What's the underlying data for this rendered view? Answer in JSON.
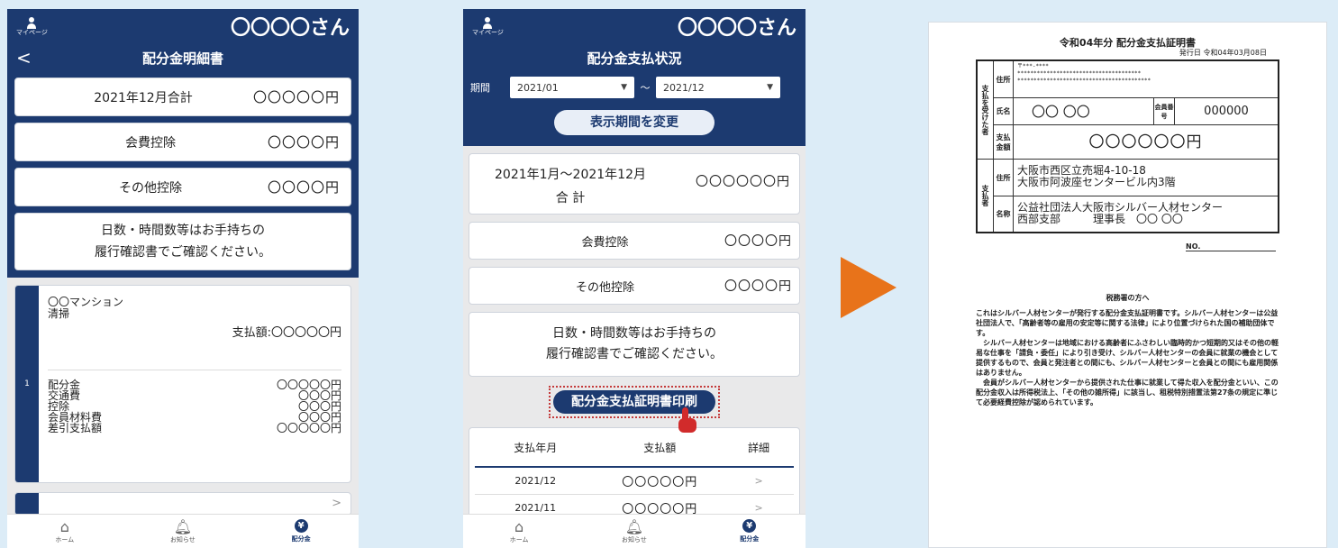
{
  "colors": {
    "navy": "#1c3a70",
    "accent_arrow": "#e8731a",
    "print_border": "#c43a3a"
  },
  "phone1": {
    "mypage_label": "マイページ",
    "user": "〇〇〇〇さん",
    "back_icon": "chevron-left-icon",
    "back": "<",
    "title": "配分金明細書",
    "total_label": "2021年12月合計",
    "total_value": "〇〇〇〇〇円",
    "fee_label": "会費控除",
    "fee_value": "〇〇〇〇円",
    "other_label": "その他控除",
    "other_value": "〇〇〇〇円",
    "note_line1": "日数・時間数等はお手持ちの",
    "note_line2": "履行確認書でご確認ください。",
    "detail": {
      "index": "1",
      "site": "〇〇マンション",
      "work": "清掃",
      "pay": "支払額:〇〇〇〇〇円",
      "items": [
        "配分金",
        "交通費",
        "控除",
        "会員材料費",
        "差引支払額"
      ],
      "values": [
        "〇〇〇〇〇円",
        "〇〇〇円",
        "〇〇〇円",
        "〇〇〇円",
        "〇〇〇〇〇円"
      ]
    },
    "next_chevron": ">"
  },
  "phone2": {
    "mypage_label": "マイページ",
    "user": "〇〇〇〇さん",
    "title": "配分金支払状況",
    "period_label": "期間",
    "from": "2021/01",
    "tilde": "〜",
    "to": "2021/12",
    "change_button": "表示期間を変更",
    "sum_period": "2021年1月〜2021年12月",
    "sum_label": "合 計",
    "sum_value": "〇〇〇〇〇〇円",
    "fee_label": "会費控除",
    "fee_value": "〇〇〇〇円",
    "other_label": "その他控除",
    "other_value": "〇〇〇〇円",
    "note_line1": "日数・時間数等はお手持ちの",
    "note_line2": "履行確認書でご確認ください。",
    "print_button": "配分金支払証明書印刷",
    "table": {
      "headers": [
        "支払年月",
        "支払額",
        "詳細"
      ],
      "rows": [
        {
          "month": "2021/12",
          "amount": "〇〇〇〇〇円",
          "detail": ">"
        },
        {
          "month": "2021/11",
          "amount": "〇〇〇〇〇円",
          "detail": ">"
        }
      ]
    }
  },
  "nav": {
    "home": "ホーム",
    "notice": "お知らせ",
    "payment": "配分金",
    "payment_icon": "¥"
  },
  "certificate": {
    "title": "令和04年分 配分金支払証明書",
    "issue": "発行日 令和04年03月08日",
    "receiver_section": "支払を受けた者",
    "payer_section": "支払者",
    "address_label": "住所",
    "zip": "〒***-****",
    "stars1": "**************************************",
    "stars2": "*****************************************",
    "name_label": "氏名",
    "name": "〇〇 〇〇",
    "member_label": "会員番号",
    "member_no": "000000",
    "amount_label": "支払金額",
    "amount": "〇〇〇〇〇〇円",
    "payer_address1": "大阪市西区立売堀4-10-18",
    "payer_address2": "大阪市阿波座センタービル内3階",
    "payer_name_label": "名称",
    "payer_name1": "公益社団法人大阪市シルバー人材センター",
    "payer_name2": "西部支部　　　理事長　〇〇 〇〇",
    "no_label": "NO.",
    "tax_heading": "税務署の方へ",
    "p1": "これはシルバー人材センターが発行する配分金支払証明書です。シルバー人材センターは公益社団法人で、「高齢者等の雇用の安定等に関する法律」により位置づけられた国の補助団体です。",
    "p2": "シルバー人材センターは地域における高齢者にふさわしい臨時的かつ短期的又はその他の軽易な仕事を「請負・委任」により引き受け、シルバー人材センターの会員に就業の機会として提供するもので、会員と発注者との間にも、シルバー人材センターと会員との間にも雇用関係はありません。",
    "p3": "会員がシルバー人材センターから提供された仕事に就業して得た収入を配分金といい、この配分金収入は所得税法上、「その他の雑所得」に該当し、租税特別措置法第27条の規定に準じて必要経費控除が認められています。"
  }
}
